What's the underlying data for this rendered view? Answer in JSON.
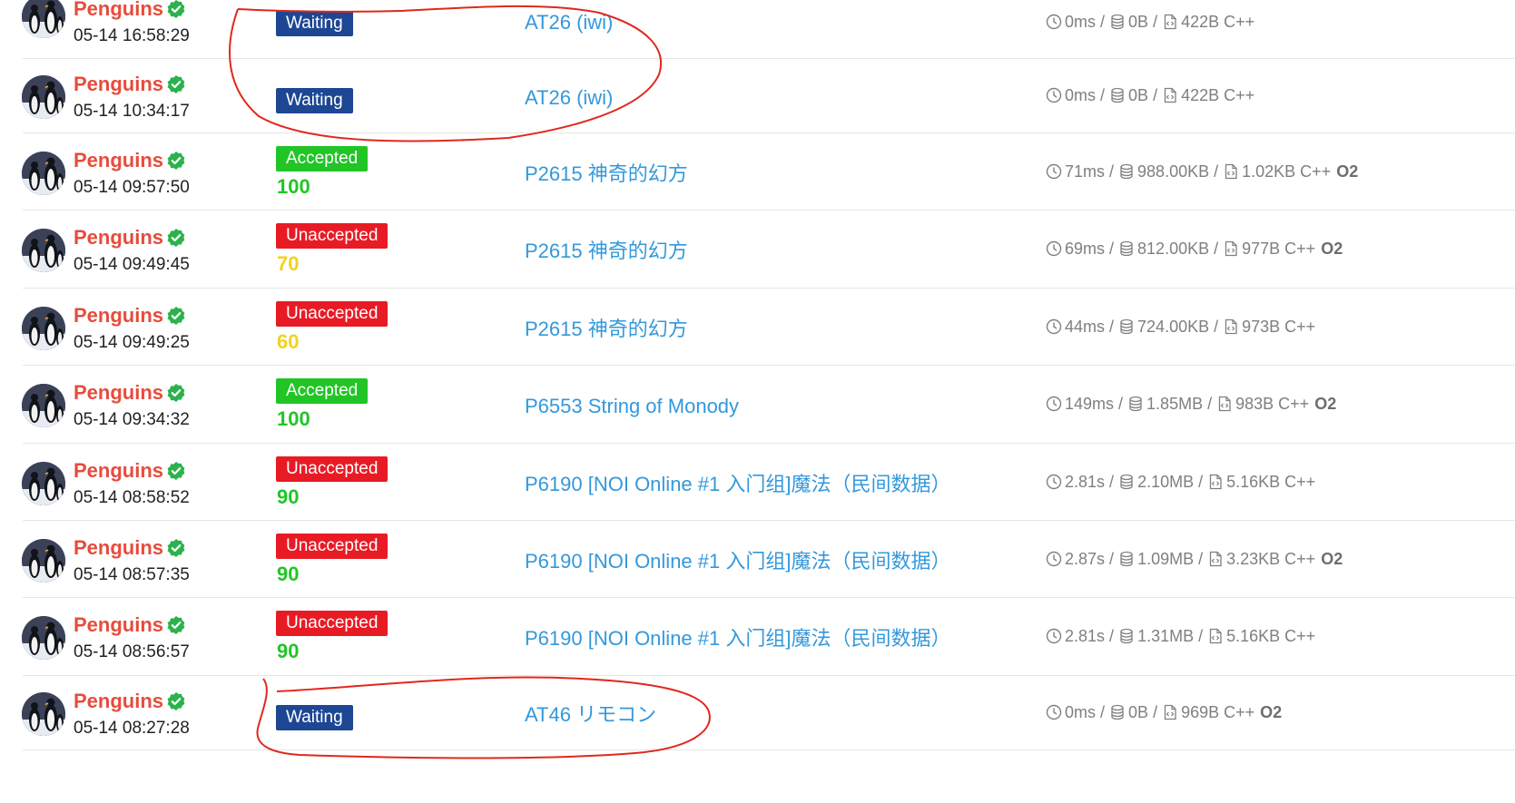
{
  "theme": {
    "user_color": "#e74c3c",
    "link_color": "#3498db",
    "verified_color": "#2bb24c",
    "status_colors": {
      "Waiting": "#1d4693",
      "Accepted": "#21c525",
      "Unaccepted": "#e81b25"
    },
    "annotation_color": "#e0281e"
  },
  "icons": {
    "time": "clock-icon",
    "memory": "database-icon",
    "code_size": "code-file-icon",
    "verified": "check-badge-icon"
  },
  "submissions": [
    {
      "user": "Penguins",
      "time": "05-14 16:58:29",
      "status": "Waiting",
      "score": "",
      "score_color": "",
      "problem": "AT26 (iwi)",
      "runtime": "0ms",
      "memory": "0B",
      "code_size": "422B",
      "lang": "C++",
      "o2": ""
    },
    {
      "user": "Penguins",
      "time": "05-14 10:34:17",
      "status": "Waiting",
      "score": "",
      "score_color": "",
      "problem": "AT26 (iwi)",
      "runtime": "0ms",
      "memory": "0B",
      "code_size": "422B",
      "lang": "C++",
      "o2": ""
    },
    {
      "user": "Penguins",
      "time": "05-14 09:57:50",
      "status": "Accepted",
      "score": "100",
      "score_color": "#21c525",
      "problem": "P2615 神奇的幻方",
      "runtime": "71ms",
      "memory": "988.00KB",
      "code_size": "1.02KB",
      "lang": "C++",
      "o2": "O2"
    },
    {
      "user": "Penguins",
      "time": "05-14 09:49:45",
      "status": "Unaccepted",
      "score": "70",
      "score_color": "#f1d21c",
      "problem": "P2615 神奇的幻方",
      "runtime": "69ms",
      "memory": "812.00KB",
      "code_size": "977B",
      "lang": "C++",
      "o2": "O2"
    },
    {
      "user": "Penguins",
      "time": "05-14 09:49:25",
      "status": "Unaccepted",
      "score": "60",
      "score_color": "#f1d21c",
      "problem": "P2615 神奇的幻方",
      "runtime": "44ms",
      "memory": "724.00KB",
      "code_size": "973B",
      "lang": "C++",
      "o2": ""
    },
    {
      "user": "Penguins",
      "time": "05-14 09:34:32",
      "status": "Accepted",
      "score": "100",
      "score_color": "#21c525",
      "problem": "P6553 String of Monody",
      "runtime": "149ms",
      "memory": "1.85MB",
      "code_size": "983B",
      "lang": "C++",
      "o2": "O2"
    },
    {
      "user": "Penguins",
      "time": "05-14 08:58:52",
      "status": "Unaccepted",
      "score": "90",
      "score_color": "#21c525",
      "problem": "P6190 [NOI Online #1 入门组]魔法（民间数据）",
      "runtime": "2.81s",
      "memory": "2.10MB",
      "code_size": "5.16KB",
      "lang": "C++",
      "o2": ""
    },
    {
      "user": "Penguins",
      "time": "05-14 08:57:35",
      "status": "Unaccepted",
      "score": "90",
      "score_color": "#21c525",
      "problem": "P6190 [NOI Online #1 入门组]魔法（民间数据）",
      "runtime": "2.87s",
      "memory": "1.09MB",
      "code_size": "3.23KB",
      "lang": "C++",
      "o2": "O2"
    },
    {
      "user": "Penguins",
      "time": "05-14 08:56:57",
      "status": "Unaccepted",
      "score": "90",
      "score_color": "#21c525",
      "problem": "P6190 [NOI Online #1 入门组]魔法（民间数据）",
      "runtime": "2.81s",
      "memory": "1.31MB",
      "code_size": "5.16KB",
      "lang": "C++",
      "o2": ""
    },
    {
      "user": "Penguins",
      "time": "05-14 08:27:28",
      "status": "Waiting",
      "score": "",
      "score_color": "",
      "problem": "AT46 リモコン",
      "runtime": "0ms",
      "memory": "0B",
      "code_size": "969B",
      "lang": "C++",
      "o2": "O2"
    }
  ]
}
